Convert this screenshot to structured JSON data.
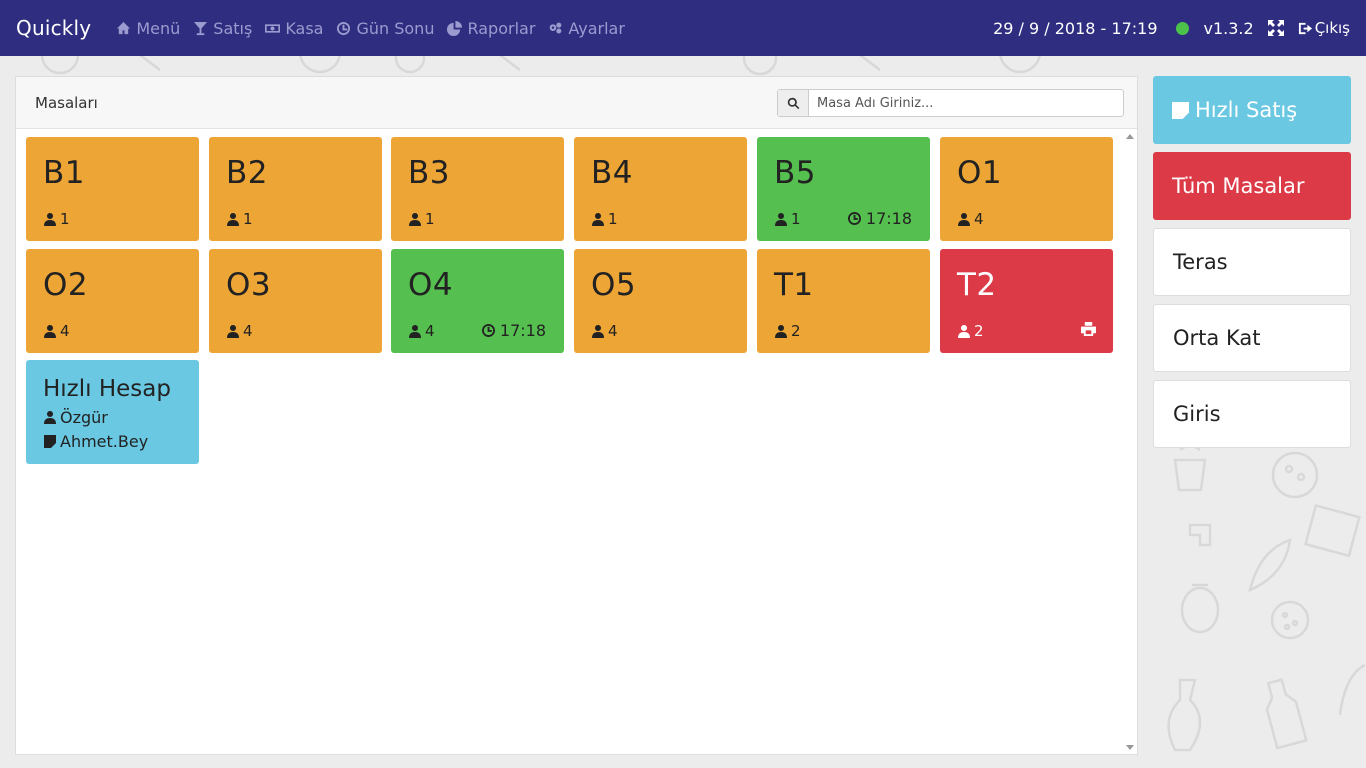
{
  "navbar": {
    "brand": "Quickly",
    "items": [
      {
        "label": "Menü",
        "icon": "home-icon"
      },
      {
        "label": "Satış",
        "icon": "cocktail-icon"
      },
      {
        "label": "Kasa",
        "icon": "money-icon"
      },
      {
        "label": "Gün Sonu",
        "icon": "clock-icon"
      },
      {
        "label": "Raporlar",
        "icon": "pie-chart-icon"
      },
      {
        "label": "Ayarlar",
        "icon": "gears-icon"
      }
    ],
    "datetime": "29 / 9 / 2018 - 17:19",
    "status_color": "#4cc24a",
    "version": "v1.3.2",
    "logout_label": "Çıkış"
  },
  "panel": {
    "title": "Masaları",
    "search_placeholder": "Masa Adı Giriniz..."
  },
  "tables": [
    {
      "name": "B1",
      "guests": "1",
      "status": "orange"
    },
    {
      "name": "B2",
      "guests": "1",
      "status": "orange"
    },
    {
      "name": "B3",
      "guests": "1",
      "status": "orange"
    },
    {
      "name": "B4",
      "guests": "1",
      "status": "orange"
    },
    {
      "name": "B5",
      "guests": "1",
      "status": "green",
      "time": "17:18"
    },
    {
      "name": "O1",
      "guests": "4",
      "status": "orange"
    },
    {
      "name": "O2",
      "guests": "4",
      "status": "orange"
    },
    {
      "name": "O3",
      "guests": "4",
      "status": "orange"
    },
    {
      "name": "O4",
      "guests": "4",
      "status": "green",
      "time": "17:18"
    },
    {
      "name": "O5",
      "guests": "4",
      "status": "orange"
    },
    {
      "name": "T1",
      "guests": "2",
      "status": "orange"
    },
    {
      "name": "T2",
      "guests": "2",
      "status": "red",
      "print": true
    }
  ],
  "quick_account": {
    "title": "Hızlı Hesap",
    "user": "Özgür",
    "note": "Ahmet.Bey"
  },
  "sidebar": {
    "quick_sale": "Hızlı Satış",
    "all_tables": "Tüm Masalar",
    "sections": [
      "Teras",
      "Orta Kat",
      "Giris"
    ]
  },
  "colors": {
    "navbar": "#2e2d80",
    "occupied": "#eda536",
    "active": "#55bf4f",
    "alert": "#db3a46",
    "info": "#6ac8e2"
  }
}
